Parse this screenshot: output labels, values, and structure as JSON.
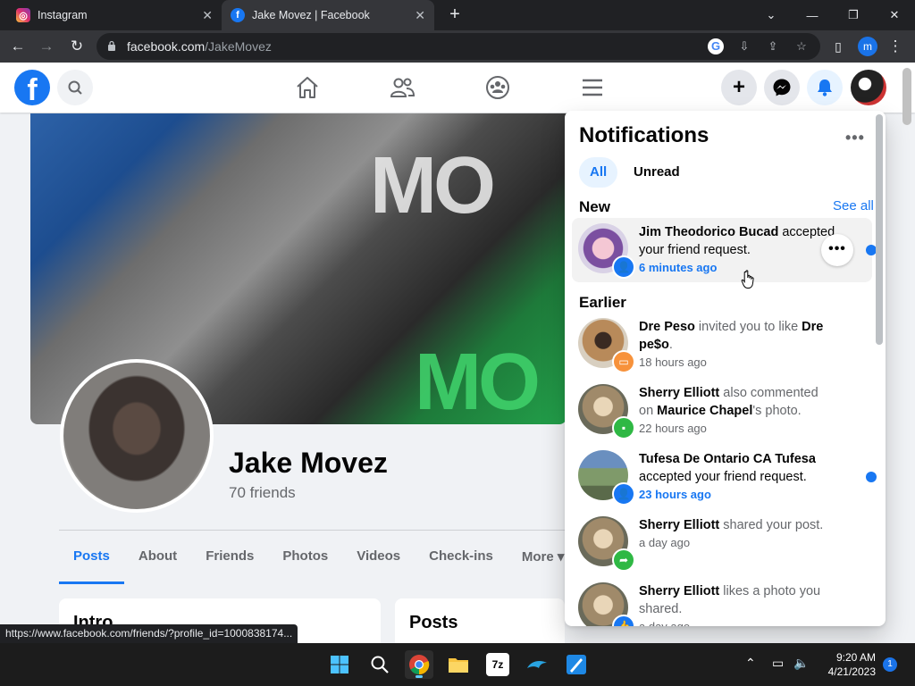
{
  "browser": {
    "tabs": [
      {
        "title": "Instagram",
        "favicon": "instagram-icon",
        "active": false
      },
      {
        "title": "Jake Movez | Facebook",
        "favicon": "facebook-icon",
        "active": true
      }
    ],
    "url_host": "facebook.com",
    "url_path": "/JakeMovez",
    "profile_initial": "m",
    "window_controls": [
      "⌄",
      "—",
      "❐",
      "✕"
    ]
  },
  "profile": {
    "name": "Jake Movez",
    "friends": "70 friends",
    "tabs": [
      "Posts",
      "About",
      "Friends",
      "Photos",
      "Videos",
      "Check-ins",
      "More ▾"
    ],
    "active_tab": "Posts",
    "intro_heading": "Intro",
    "posts_heading": "Posts"
  },
  "cover": {
    "text_top": "MO",
    "text_bottom": "MO"
  },
  "notifications": {
    "title": "Notifications",
    "more": "•••",
    "filters": [
      "All",
      "Unread"
    ],
    "section_new": "New",
    "see_all": "See all",
    "section_earlier": "Earlier",
    "options": "•••",
    "items": [
      {
        "actor": "Jim Theodorico Bucad",
        "text": " accepted your friend request.",
        "time": "6 minutes ago",
        "unread": true
      },
      {
        "actor": "Dre Peso",
        "text": " invited you to like ",
        "actor2": "Dre pe$o",
        "text2": ".",
        "time": "18 hours ago",
        "unread": false
      },
      {
        "actor": "Sherry Elliott",
        "text": " also commented on ",
        "actor2": "Maurice Chapel",
        "text2": "'s photo.",
        "time": "22 hours ago",
        "unread": false
      },
      {
        "actor": "Tufesa De Ontario CA Tufesa",
        "text": " accepted your friend request.",
        "time": "23 hours ago",
        "unread": true
      },
      {
        "actor": "Sherry Elliott",
        "text": " shared your post.",
        "time": "a day ago",
        "unread": false
      },
      {
        "actor": "Sherry Elliott",
        "text": " likes a photo you shared.",
        "time": "a day ago",
        "unread": false
      }
    ]
  },
  "status_url": "https://www.facebook.com/friends/?profile_id=1000838174...",
  "taskbar": {
    "time": "9:20 AM",
    "date": "4/21/2023",
    "notification_count": "1",
    "app_7z_label": "7z"
  },
  "colors": {
    "brand": "#1877f2",
    "unread_dot": "#1877f2"
  }
}
